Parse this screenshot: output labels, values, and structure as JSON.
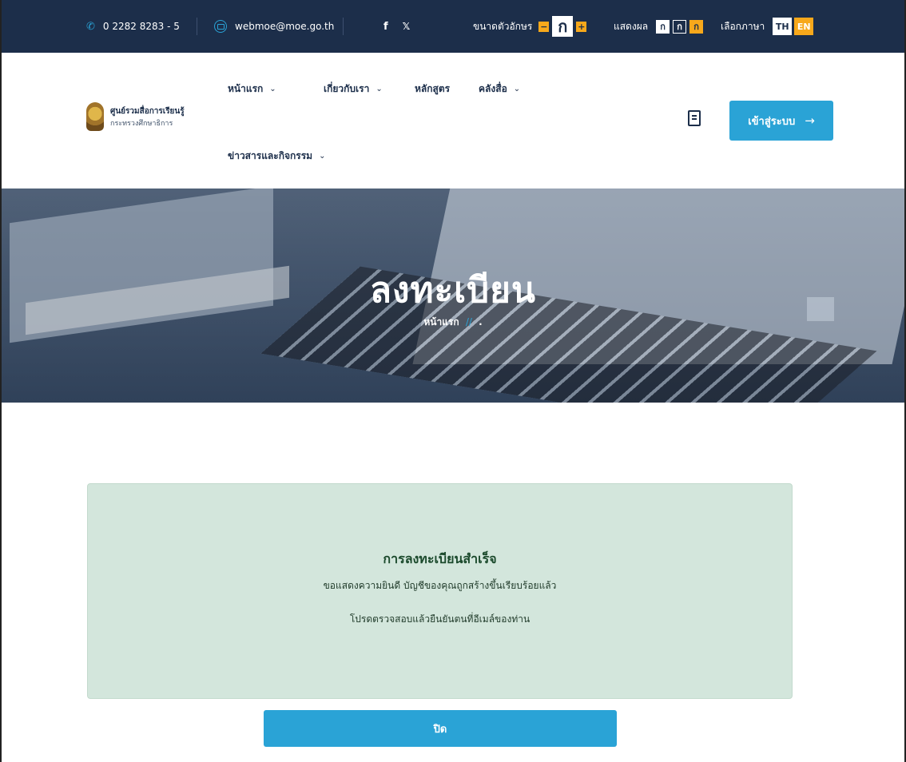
{
  "topbar": {
    "phone": "0 2282 8283 - 5",
    "email": "webmoe@moe.go.th",
    "facebook": "f",
    "twitter": "🐦",
    "font_size_label": "ขนาดตัวอักษร",
    "font_minus": "−",
    "font_current": "ก",
    "font_plus": "+",
    "display_label": "แสดงผล",
    "display_opt1": "ก",
    "display_opt2": "ก",
    "display_opt3": "ก",
    "language_label": "เลือกภาษา",
    "lang_th": "TH",
    "lang_en": "EN"
  },
  "header": {
    "logo_title": "ศูนย์รวมสื่อการเรียนรู้",
    "logo_subtitle": "กระทรวงศึกษาธิการ",
    "nav": {
      "home": "หน้าแรก",
      "about": "เกี่ยวกับเรา",
      "courses": "หลักสูตร",
      "library": "คลังสื่อ",
      "news": "ข่าวสารและกิจกรรม"
    },
    "chevron": "⌄",
    "login_label": "เข้าสู่ระบบ",
    "login_arrow": "→"
  },
  "hero": {
    "title": "ลงทะเบียน",
    "breadcrumb_home": "หน้าแรก",
    "breadcrumb_sep": "//",
    "breadcrumb_current": "."
  },
  "alert": {
    "heading": "การลงทะเบียนสำเร็จ",
    "message1": "ขอแสดงความยินดี บัญชีของคุณถูกสร้างขึ้นเรียบร้อยแล้ว",
    "message2": "โปรดตรวจสอบแล้วยืนยันตนที่อีเมล์ของท่าน"
  },
  "close_button": "ปิด",
  "colors": {
    "topbar_bg": "#1c2e4a",
    "accent": "#2aa3d6",
    "orange": "#f7a81b",
    "alert_bg": "#d3e6dc"
  }
}
